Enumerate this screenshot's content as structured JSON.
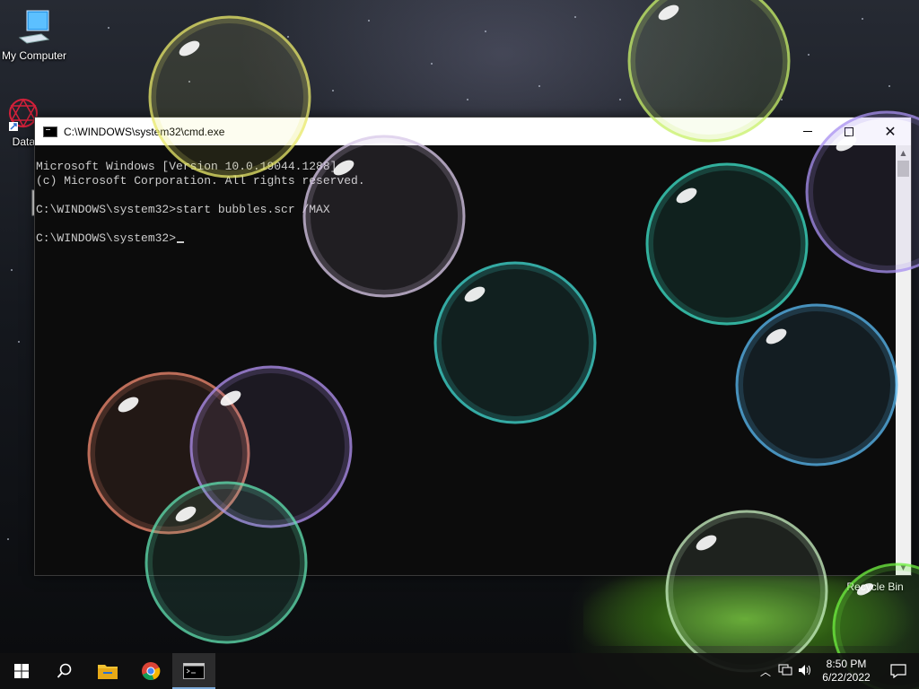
{
  "desktop": {
    "icons": [
      {
        "label": "My Computer",
        "icon": "computer-icon"
      },
      {
        "label": "DataW",
        "icon": "datawrapper-icon"
      },
      {
        "label": "",
        "icon": "settings-shortcut-icon"
      },
      {
        "label": "Recycle Bin",
        "icon": "recycle-bin-icon"
      }
    ]
  },
  "cmd_window": {
    "title": "C:\\WINDOWS\\system32\\cmd.exe",
    "lines": [
      "Microsoft Windows [Version 10.0.19044.1288]",
      "(c) Microsoft Corporation. All rights reserved.",
      "",
      "C:\\WINDOWS\\system32>start bubbles.scr /MAX",
      "",
      "C:\\WINDOWS\\system32>"
    ],
    "controls": {
      "minimize": "minimize",
      "maximize": "maximize",
      "close": "close"
    }
  },
  "screensaver": {
    "name": "bubbles.scr",
    "bubble_colors": [
      "#e8e86a",
      "#c8f06a",
      "#d8c8e8",
      "#3ee0c8",
      "#a890f0",
      "#40d8d0",
      "#5ab8f0",
      "#f08a70",
      "#b090f0",
      "#60e0b0",
      "#c8f0c0",
      "#70f040"
    ]
  },
  "taskbar": {
    "items": [
      {
        "name": "start",
        "icon": "windows-start-icon"
      },
      {
        "name": "search",
        "icon": "search-icon"
      },
      {
        "name": "file-explorer",
        "icon": "folder-icon"
      },
      {
        "name": "chrome",
        "icon": "chrome-icon"
      },
      {
        "name": "command-prompt",
        "icon": "cmd-icon",
        "active": true
      }
    ],
    "tray": {
      "time": "8:50 PM",
      "date": "6/22/2022"
    }
  }
}
